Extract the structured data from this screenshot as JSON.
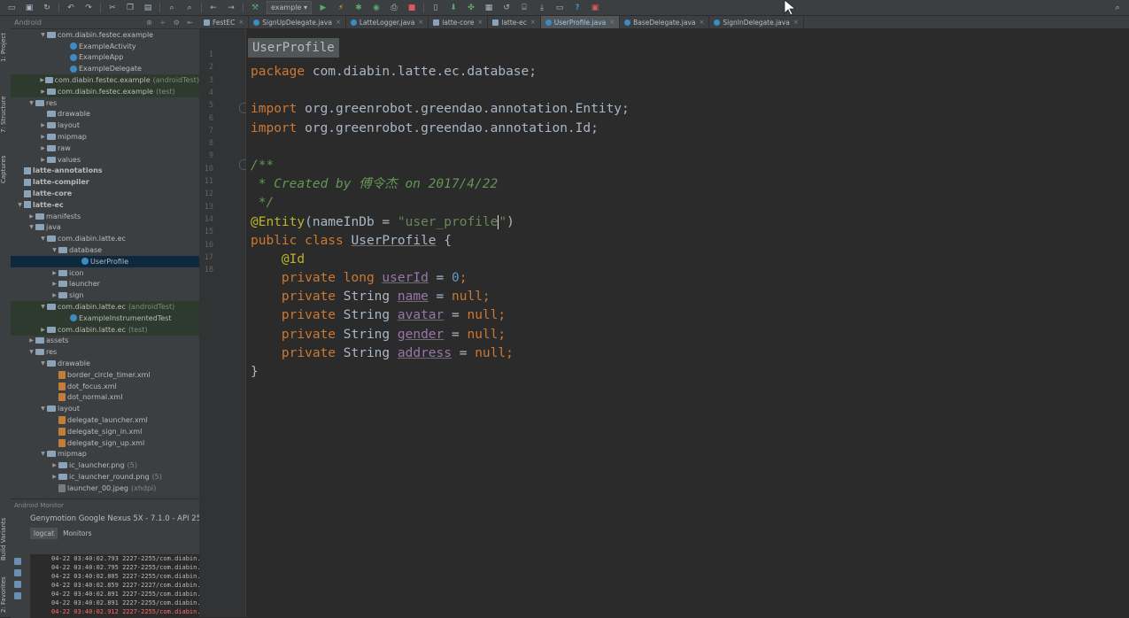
{
  "toolbar": {
    "run_config": "example"
  },
  "sidebar_strip": {
    "project": "1: Project",
    "structure": "7: Structure",
    "captures": "Captures",
    "build_variants": "Build Variants",
    "favorites": "2: Favorites"
  },
  "project_panel": {
    "view": "Android",
    "tree": [
      {
        "label": "com.diabin.festec.example",
        "indent": 1,
        "icon": "folder",
        "arrow": "▼",
        "suffix": ""
      },
      {
        "label": "ExampleActivity",
        "indent": 3,
        "icon": "java",
        "arrow": "",
        "suffix": ""
      },
      {
        "label": "ExampleApp",
        "indent": 3,
        "icon": "java",
        "arrow": "",
        "suffix": ""
      },
      {
        "label": "ExampleDelegate",
        "indent": 3,
        "icon": "java",
        "arrow": "",
        "suffix": ""
      },
      {
        "label": "com.diabin.festec.example",
        "indent": 1,
        "icon": "folder",
        "arrow": "▶",
        "suffix": "(androidTest)",
        "green": true
      },
      {
        "label": "com.diabin.festec.example",
        "indent": 1,
        "icon": "folder",
        "arrow": "▶",
        "suffix": "(test)",
        "green": true
      },
      {
        "label": "res",
        "indent": 0,
        "icon": "folder",
        "arrow": "▼",
        "suffix": ""
      },
      {
        "label": "drawable",
        "indent": 1,
        "icon": "folder",
        "arrow": "",
        "suffix": ""
      },
      {
        "label": "layout",
        "indent": 1,
        "icon": "folder",
        "arrow": "▶",
        "suffix": ""
      },
      {
        "label": "mipmap",
        "indent": 1,
        "icon": "folder",
        "arrow": "▶",
        "suffix": ""
      },
      {
        "label": "raw",
        "indent": 1,
        "icon": "folder",
        "arrow": "▶",
        "suffix": ""
      },
      {
        "label": "values",
        "indent": 1,
        "icon": "folder",
        "arrow": "▶",
        "suffix": ""
      },
      {
        "label": "latte-annotations",
        "indent": -1,
        "icon": "mod",
        "arrow": "",
        "suffix": "",
        "bold": true
      },
      {
        "label": "latte-compiler",
        "indent": -1,
        "icon": "mod",
        "arrow": "",
        "suffix": "",
        "bold": true
      },
      {
        "label": "latte-core",
        "indent": -1,
        "icon": "mod",
        "arrow": "",
        "suffix": "",
        "bold": true
      },
      {
        "label": "latte-ec",
        "indent": -1,
        "icon": "mod",
        "arrow": "▼",
        "suffix": "",
        "bold": true
      },
      {
        "label": "manifests",
        "indent": 0,
        "icon": "folder",
        "arrow": "▶",
        "suffix": ""
      },
      {
        "label": "java",
        "indent": 0,
        "icon": "folder",
        "arrow": "▼",
        "suffix": ""
      },
      {
        "label": "com.diabin.latte.ec",
        "indent": 1,
        "icon": "folder",
        "arrow": "▼",
        "suffix": ""
      },
      {
        "label": "database",
        "indent": 2,
        "icon": "folder",
        "arrow": "▼",
        "suffix": ""
      },
      {
        "label": "UserProfile",
        "indent": 4,
        "icon": "java",
        "arrow": "",
        "suffix": "",
        "selected": true
      },
      {
        "label": "icon",
        "indent": 2,
        "icon": "folder",
        "arrow": "▶",
        "suffix": ""
      },
      {
        "label": "launcher",
        "indent": 2,
        "icon": "folder",
        "arrow": "▶",
        "suffix": ""
      },
      {
        "label": "sign",
        "indent": 2,
        "icon": "folder",
        "arrow": "▶",
        "suffix": ""
      },
      {
        "label": "com.diabin.latte.ec",
        "indent": 1,
        "icon": "folder",
        "arrow": "▼",
        "suffix": "(androidTest)",
        "green": true
      },
      {
        "label": "ExampleInstrumentedTest",
        "indent": 3,
        "icon": "java",
        "arrow": "",
        "suffix": "",
        "green": true
      },
      {
        "label": "com.diabin.latte.ec",
        "indent": 1,
        "icon": "folder",
        "arrow": "▶",
        "suffix": "(test)",
        "green": true
      },
      {
        "label": "assets",
        "indent": 0,
        "icon": "folder",
        "arrow": "▶",
        "suffix": ""
      },
      {
        "label": "res",
        "indent": 0,
        "icon": "folder",
        "arrow": "▼",
        "suffix": ""
      },
      {
        "label": "drawable",
        "indent": 1,
        "icon": "folder",
        "arrow": "▼",
        "suffix": ""
      },
      {
        "label": "border_circle_timer.xml",
        "indent": 2,
        "icon": "xml",
        "arrow": "",
        "suffix": ""
      },
      {
        "label": "dot_focus.xml",
        "indent": 2,
        "icon": "xml",
        "arrow": "",
        "suffix": ""
      },
      {
        "label": "dot_normal.xml",
        "indent": 2,
        "icon": "xml",
        "arrow": "",
        "suffix": ""
      },
      {
        "label": "layout",
        "indent": 1,
        "icon": "folder",
        "arrow": "▼",
        "suffix": ""
      },
      {
        "label": "delegate_launcher.xml",
        "indent": 2,
        "icon": "xml",
        "arrow": "",
        "suffix": ""
      },
      {
        "label": "delegate_sign_in.xml",
        "indent": 2,
        "icon": "xml",
        "arrow": "",
        "suffix": ""
      },
      {
        "label": "delegate_sign_up.xml",
        "indent": 2,
        "icon": "xml",
        "arrow": "",
        "suffix": ""
      },
      {
        "label": "mipmap",
        "indent": 1,
        "icon": "folder",
        "arrow": "▼",
        "suffix": ""
      },
      {
        "label": "ic_launcher.png",
        "indent": 2,
        "icon": "folder",
        "arrow": "▶",
        "suffix": "(5)"
      },
      {
        "label": "ic_launcher_round.png",
        "indent": 2,
        "icon": "folder",
        "arrow": "▶",
        "suffix": "(5)"
      },
      {
        "label": "launcher_00.jpeg",
        "indent": 2,
        "icon": "img",
        "arrow": "",
        "suffix": "(xhdpi)"
      }
    ]
  },
  "android_monitor": {
    "title": "Android Monitor",
    "device": "Genymotion Google Nexus 5X - 7.1.0 - API 25 -",
    "tabs": [
      "logcat",
      "Monitors"
    ],
    "log_lines": [
      {
        "text": "04-22 03:40:02.793 2227-2255/com.diabin.fe",
        "error": false
      },
      {
        "text": "04-22 03:40:02.795 2227-2255/com.diabin.fe",
        "error": false
      },
      {
        "text": "04-22 03:40:02.805 2227-2255/com.diabin.fe",
        "error": false
      },
      {
        "text": "04-22 03:40:02.859 2227-2227/com.diabin.fe",
        "error": false
      },
      {
        "text": "04-22 03:40:02.891 2227-2255/com.diabin.fe",
        "error": false
      },
      {
        "text": "04-22 03:40:02.891 2227-2255/com.diabin.fe",
        "error": false
      },
      {
        "text": "04-22 03:40:02.912 2227-2255/com.diabin.fe",
        "error": true
      }
    ]
  },
  "editor_tabs": [
    {
      "label": "FestEC",
      "icon": "mod",
      "active": false
    },
    {
      "label": "SignUpDelegate.java",
      "icon": "java",
      "active": false
    },
    {
      "label": "LatteLogger.java",
      "icon": "java",
      "active": false
    },
    {
      "label": "latte-core",
      "icon": "mod",
      "active": false
    },
    {
      "label": "latte-ec",
      "icon": "mod",
      "active": false
    },
    {
      "label": "UserProfile.java",
      "icon": "java",
      "active": true
    },
    {
      "label": "BaseDelegate.java",
      "icon": "java",
      "active": false
    },
    {
      "label": "SignInDelegate.java",
      "icon": "java",
      "active": false
    }
  ],
  "editor": {
    "breadcrumb": "UserProfile",
    "line_numbers": [
      "1",
      "2",
      "3",
      "4",
      "5",
      "6",
      "7",
      "8",
      "9",
      "10",
      "11",
      "12",
      "13",
      "14",
      "15",
      "16",
      "17",
      "18"
    ],
    "code": {
      "l1_kw": "package",
      "l1_rest": " com.diabin.latte.ec.database;",
      "l3_kw": "import",
      "l3_rest": " org.greenrobot.greendao.annotation.Entity;",
      "l4_kw": "import",
      "l4_rest": " org.greenrobot.greendao.annotation.Id;",
      "l6": "/**",
      "l7": " * Created by 傅令杰 on 2017/4/22",
      "l8": " */",
      "l9_ann": "@Entity",
      "l9_param": "(nameInDb = ",
      "l9_str_a": "\"user_profile",
      "l9_str_b": "\"",
      "l9_close": ")",
      "l10_kw": "public class",
      "l10_cls": "UserProfile",
      "l10_rest": " {",
      "l11_ann": "@Id",
      "l12_kw": "private long",
      "l12_fld": "userId",
      "l12_eq": " = ",
      "l12_num": "0",
      "l12_end": ";",
      "l13_kw": "private",
      "l13_type": " String ",
      "l13_fld": "name",
      "l13_eq": " = ",
      "l13_null": "null",
      "l13_end": ";",
      "l14_kw": "private",
      "l14_type": " String ",
      "l14_fld": "avatar",
      "l14_eq": " = ",
      "l14_null": "null",
      "l14_end": ";",
      "l15_kw": "private",
      "l15_type": " String ",
      "l15_fld": "gender",
      "l15_eq": " = ",
      "l15_null": "null",
      "l15_end": ";",
      "l16_kw": "private",
      "l16_type": " String ",
      "l16_fld": "address",
      "l16_eq": " = ",
      "l16_null": "null",
      "l16_end": ";",
      "l17": "}"
    }
  }
}
